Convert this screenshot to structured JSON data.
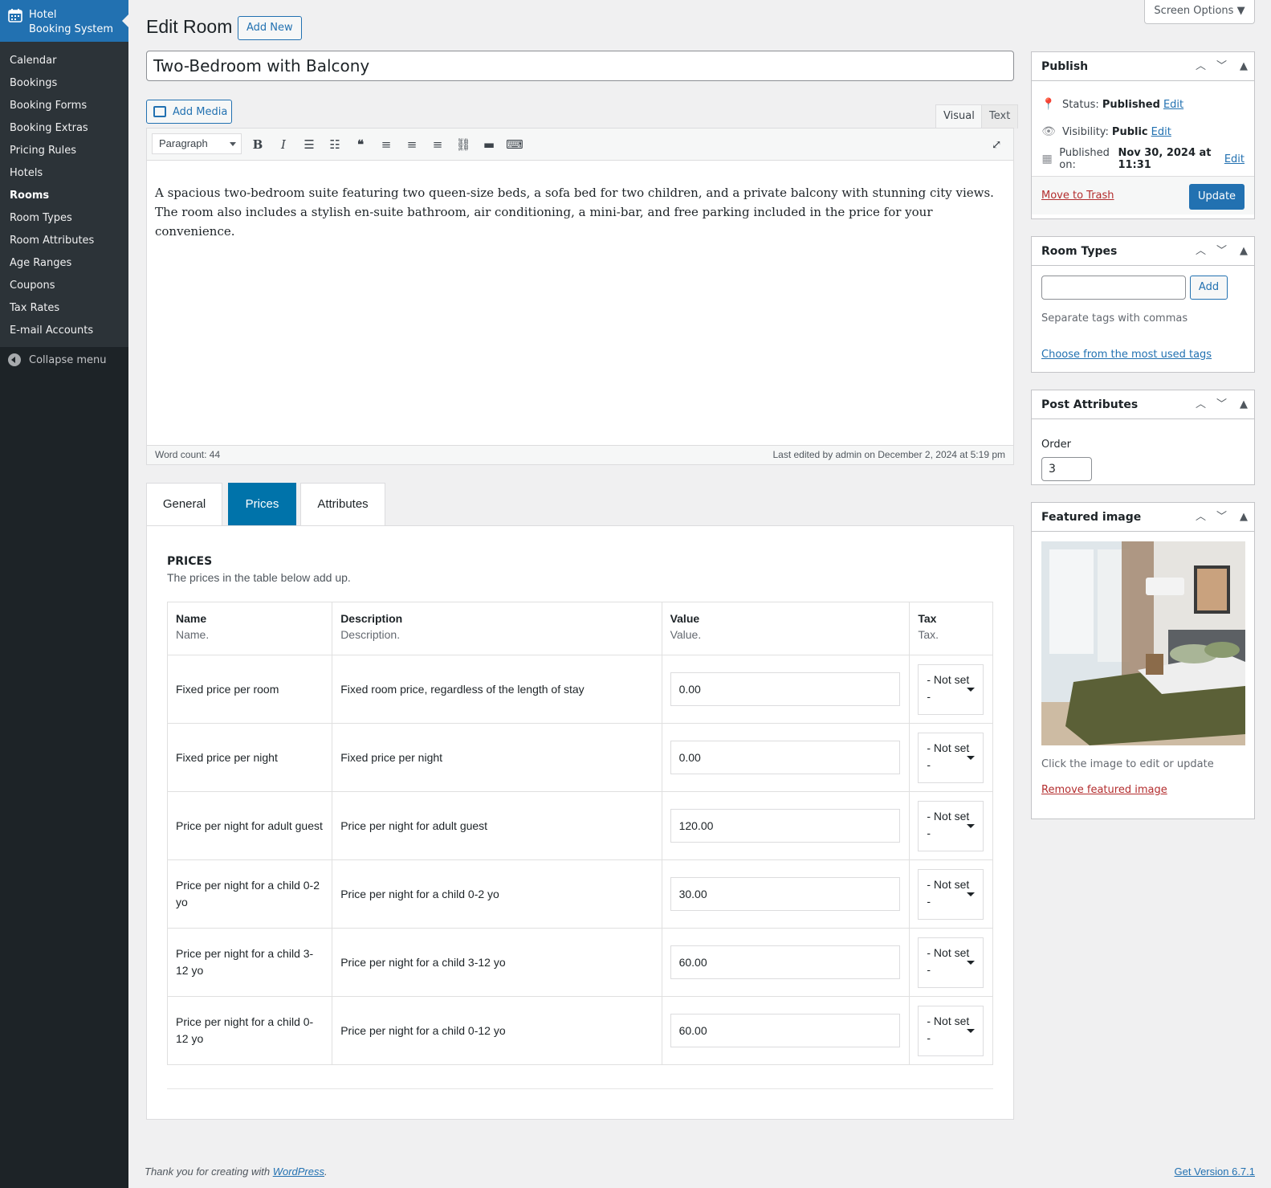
{
  "sidebar": {
    "brand": "Hotel Booking System",
    "brand_line1": "Hotel",
    "brand_line2": "Booking System",
    "items": [
      {
        "label": "Calendar"
      },
      {
        "label": "Bookings"
      },
      {
        "label": "Booking Forms"
      },
      {
        "label": "Booking Extras"
      },
      {
        "label": "Pricing Rules"
      },
      {
        "label": "Hotels"
      },
      {
        "label": "Rooms",
        "current": true
      },
      {
        "label": "Room Types"
      },
      {
        "label": "Room Attributes"
      },
      {
        "label": "Age Ranges"
      },
      {
        "label": "Coupons"
      },
      {
        "label": "Tax Rates"
      },
      {
        "label": "E-mail Accounts"
      }
    ],
    "collapse": "Collapse menu"
  },
  "header": {
    "title": "Edit Room",
    "add_new": "Add New",
    "screen_options": "Screen Options"
  },
  "post": {
    "title": "Two-Bedroom with Balcony",
    "add_media": "Add Media",
    "tab_visual": "Visual",
    "tab_text": "Text",
    "format": "Paragraph",
    "content": "A spacious two-bedroom suite featuring two queen-size beds, a sofa bed for two children, and a private balcony with stunning city views. The room also includes a stylish en-suite bathroom, air conditioning, a mini-bar, and free parking included in the price for your convenience.",
    "word_count": "Word count: 44",
    "last_edited": "Last edited by admin on December 2, 2024 at 5:19 pm"
  },
  "tabs": {
    "general": "General",
    "prices": "Prices",
    "attributes": "Attributes",
    "active": "Prices"
  },
  "prices": {
    "heading": "PRICES",
    "description": "The prices in the table below add up.",
    "columns": [
      {
        "label": "Name",
        "sub": "Name."
      },
      {
        "label": "Description",
        "sub": "Description."
      },
      {
        "label": "Value",
        "sub": "Value."
      },
      {
        "label": "Tax",
        "sub": "Tax."
      }
    ],
    "rows": [
      {
        "name": "Fixed price per room",
        "description": "Fixed room price, regardless of the length of stay",
        "value": "0.00",
        "tax": "- Not set -"
      },
      {
        "name": "Fixed price per night",
        "description": "Fixed price per night",
        "value": "0.00",
        "tax": "- Not set -"
      },
      {
        "name": "Price per night for adult guest",
        "description": "Price per night for adult guest",
        "value": "120.00",
        "tax": "- Not set -"
      },
      {
        "name": "Price per night for a child 0-2 yo",
        "description": "Price per night for a child 0-2 yo",
        "value": "30.00",
        "tax": "- Not set -"
      },
      {
        "name": "Price per night for a child 3-12 yo",
        "description": "Price per night for a child 3-12 yo",
        "value": "60.00",
        "tax": "- Not set -"
      },
      {
        "name": "Price per night for a child 0-12 yo",
        "description": "Price per night for a child 0-12 yo",
        "value": "60.00",
        "tax": "- Not set -"
      }
    ]
  },
  "publish": {
    "title": "Publish",
    "status_label": "Status:",
    "status_value": "Published",
    "visibility_label": "Visibility:",
    "visibility_value": "Public",
    "published_label": "Published on:",
    "published_value": "Nov 30, 2024 at 11:31",
    "edit": "Edit",
    "trash": "Move to Trash",
    "update": "Update"
  },
  "room_types": {
    "title": "Room Types",
    "input_value": "",
    "add": "Add",
    "help": "Separate tags with commas",
    "most_used": "Choose from the most used tags"
  },
  "post_attributes": {
    "title": "Post Attributes",
    "order_label": "Order",
    "order_value": "3"
  },
  "featured_image": {
    "title": "Featured image",
    "help": "Click the image to edit or update",
    "remove": "Remove featured image"
  },
  "footer": {
    "thanks_prefix": "Thank you for creating with ",
    "wordpress": "WordPress",
    "thanks_suffix": ".",
    "version": "Get Version 6.7.1"
  },
  "colors": {
    "admin_blue": "#2271b1",
    "tab_active": "#0073aa",
    "sidebar_bg": "#1d2327",
    "danger": "#b32d2e"
  }
}
